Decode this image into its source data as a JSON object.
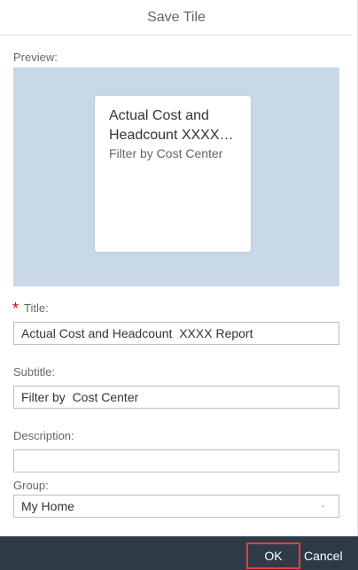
{
  "dialog": {
    "title": "Save Tile"
  },
  "preview": {
    "label": "Preview:",
    "tile_title": "Actual Cost and Headcount  XXXX Report",
    "tile_subtitle": "Filter by  Cost Center"
  },
  "form": {
    "required_marker": "*",
    "title_label": "Title:",
    "title_value": "Actual Cost and Headcount  XXXX Report",
    "subtitle_label": "Subtitle:",
    "subtitle_value": "Filter by  Cost Center",
    "description_label": "Description:",
    "description_value": "",
    "group_label": "Group:",
    "group_value": "My Home"
  },
  "footer": {
    "ok_label": "OK",
    "cancel_label": "Cancel"
  },
  "colors": {
    "preview_background": "#c9d8e6",
    "footer_background": "#2e3b47",
    "ok_highlight_border": "#e2403f",
    "required_marker": "#e00000"
  }
}
